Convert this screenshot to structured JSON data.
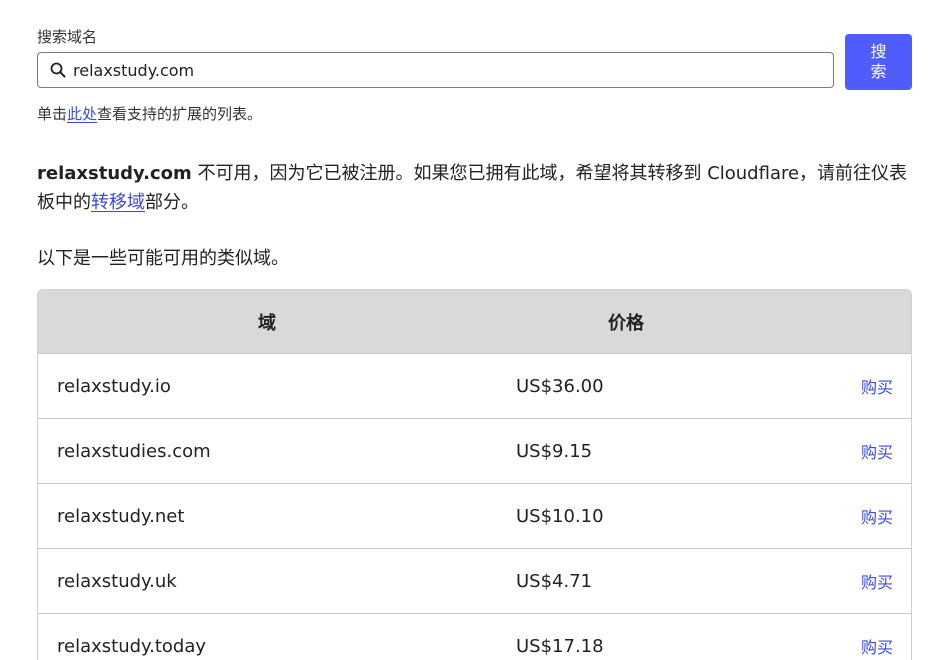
{
  "search": {
    "label": "搜索域名",
    "value": "relaxstudy.com",
    "button_line1": "搜",
    "button_line2": "索"
  },
  "hint": {
    "before": "单击",
    "link": "此处",
    "after": "查看支持的扩展的列表。"
  },
  "status": {
    "domain": "relaxstudy.com",
    "text_before_link": " 不可用，因为它已被注册。如果您已拥有此域，希望将其转移到 Cloudflare，请前往仪表板中的",
    "link": "转移域",
    "text_after_link": "部分。"
  },
  "similar_intro": "以下是一些可能可用的类似域。",
  "table": {
    "headers": {
      "domain": "域",
      "price": "价格"
    },
    "rows": [
      {
        "domain": "relaxstudy.io",
        "price": "US$36.00",
        "action": "购买"
      },
      {
        "domain": "relaxstudies.com",
        "price": "US$9.15",
        "action": "购买"
      },
      {
        "domain": "relaxstudy.net",
        "price": "US$10.10",
        "action": "购买"
      },
      {
        "domain": "relaxstudy.uk",
        "price": "US$4.71",
        "action": "购买"
      },
      {
        "domain": "relaxstudy.today",
        "price": "US$17.18",
        "action": "购买"
      }
    ]
  },
  "colors": {
    "accent": "#4f5dff",
    "link": "#3d4bd9",
    "table_header_bg": "#d9d9d9"
  }
}
